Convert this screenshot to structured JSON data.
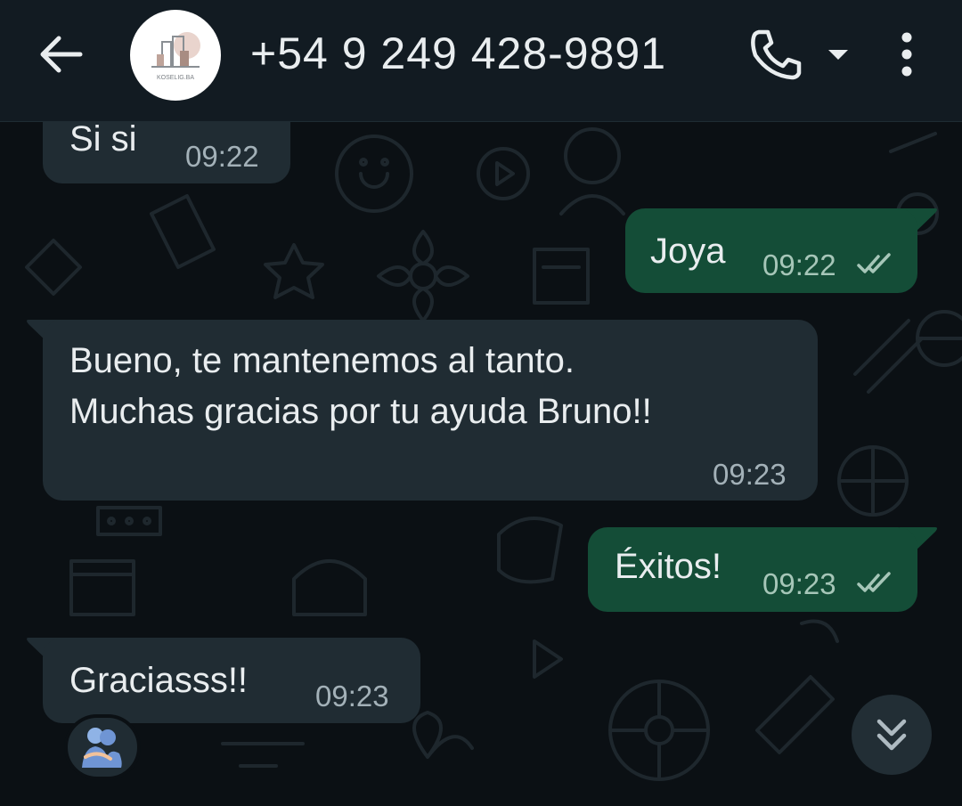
{
  "header": {
    "contact_name": "+54 9 249 428-9891",
    "avatar_logo_text": "KOSELIG.BA",
    "back_icon": "arrow-left-icon",
    "call_icon": "phone-icon",
    "dropdown_icon": "caret-down-icon",
    "menu_icon": "more-vertical-icon"
  },
  "messages": [
    {
      "direction": "incoming",
      "text": "Si si",
      "time": "09:22"
    },
    {
      "direction": "outgoing",
      "text": "Joya",
      "time": "09:22",
      "status": "read-double-check"
    },
    {
      "direction": "incoming",
      "lines": [
        "Bueno, te mantenemos al tanto.",
        "Muchas gracias por tu ayuda Bruno!!"
      ],
      "time": "09:23"
    },
    {
      "direction": "outgoing",
      "text": "Éxitos!",
      "time": "09:23",
      "status": "read-double-check"
    },
    {
      "direction": "incoming",
      "text": "Graciasss!!",
      "time": "09:23",
      "reaction": "people-hugging-emoji"
    }
  ],
  "scroll_button_icon": "double-chevron-down-icon",
  "colors": {
    "header_bg": "#121b22",
    "chat_bg": "#0b1014",
    "incoming_bubble": "#202c33",
    "outgoing_bubble": "#144d37",
    "text": "#e9edef",
    "time": "#a3b1b8",
    "ticks": "#a6c6b8"
  }
}
